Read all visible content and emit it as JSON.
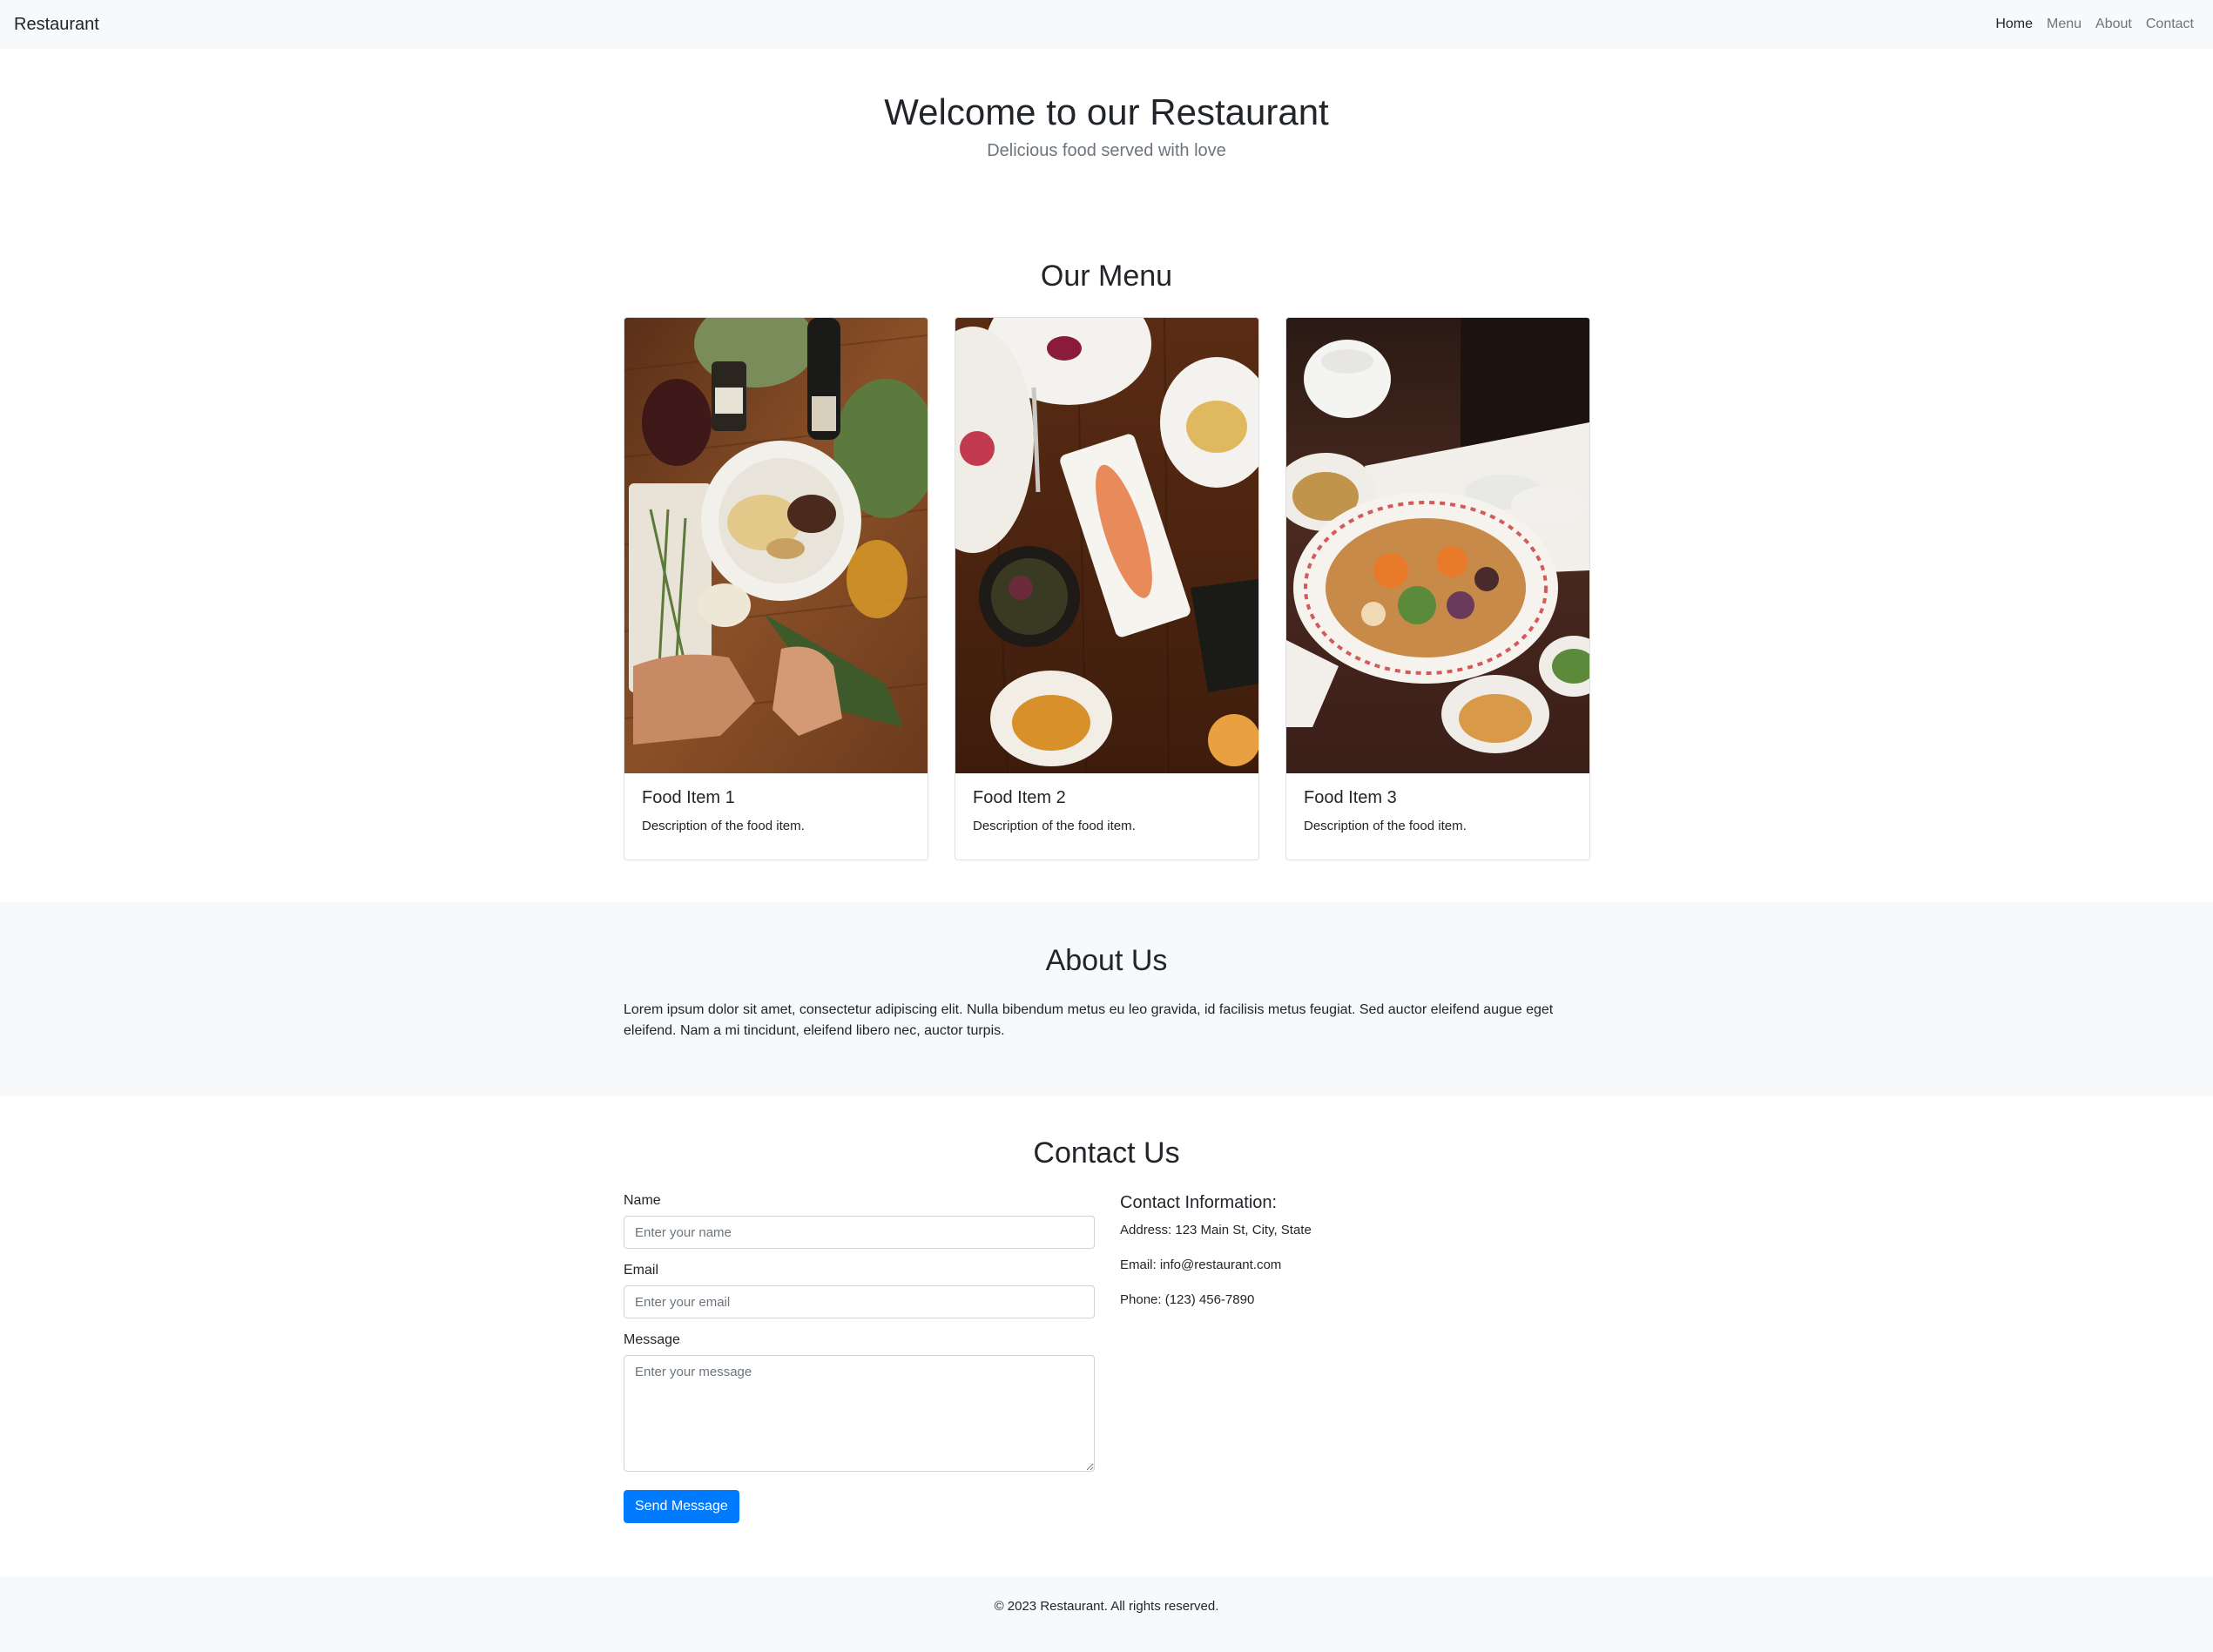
{
  "navbar": {
    "brand": "Restaurant",
    "links": [
      "Home",
      "Menu",
      "About",
      "Contact"
    ],
    "active": "Home"
  },
  "hero": {
    "title": "Welcome to our Restaurant",
    "subtitle": "Delicious food served with love"
  },
  "menu": {
    "title": "Our Menu",
    "items": [
      {
        "title": "Food Item 1",
        "description": "Description of the food item.",
        "image": "food-photo-1"
      },
      {
        "title": "Food Item 2",
        "description": "Description of the food item.",
        "image": "food-photo-2"
      },
      {
        "title": "Food Item 3",
        "description": "Description of the food item.",
        "image": "food-photo-3"
      }
    ]
  },
  "about": {
    "title": "About Us",
    "text": "Lorem ipsum dolor sit amet, consectetur adipiscing elit. Nulla bibendum metus eu leo gravida, id facilisis metus feugiat. Sed auctor eleifend augue eget eleifend. Nam a mi tincidunt, eleifend libero nec, auctor turpis."
  },
  "contact": {
    "title": "Contact Us",
    "form": {
      "name_label": "Name",
      "name_placeholder": "Enter your name",
      "email_label": "Email",
      "email_placeholder": "Enter your email",
      "message_label": "Message",
      "message_placeholder": "Enter your message",
      "submit_label": "Send Message"
    },
    "info": {
      "heading": "Contact Information:",
      "address": "Address: 123 Main St, City, State",
      "email": "Email: info@restaurant.com",
      "phone": "Phone: (123) 456-7890"
    }
  },
  "footer": {
    "text": "© 2023 Restaurant. All rights reserved."
  },
  "colors": {
    "primary": "#007bff",
    "light_bg": "#f8f9fa",
    "text": "#212529",
    "muted": "#6c757d"
  }
}
